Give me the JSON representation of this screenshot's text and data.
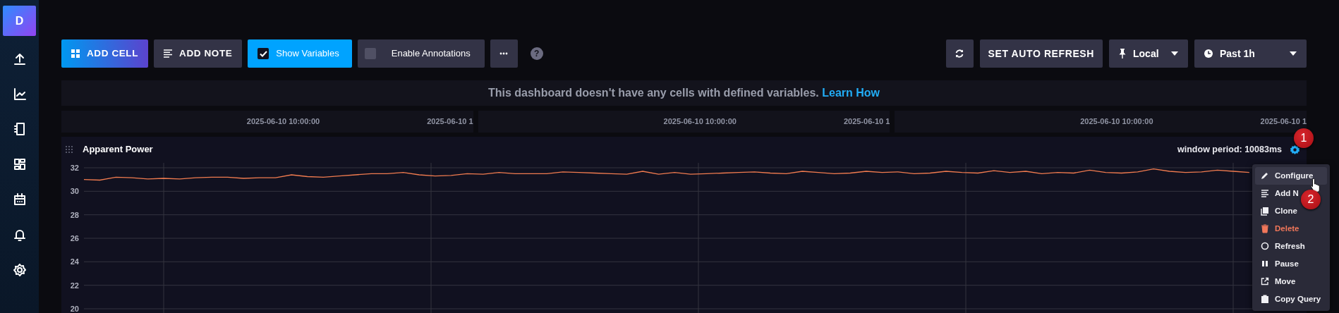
{
  "sidebar": {
    "logo": "D"
  },
  "toolbar": {
    "add_cell": "ADD CELL",
    "add_note": "ADD NOTE",
    "show_variables": {
      "label": "Show Variables",
      "checked": true
    },
    "enable_annotations": {
      "label": "Enable Annotations",
      "checked": false
    },
    "help": "?",
    "auto_refresh": "SET AUTO REFRESH",
    "timezone": "Local",
    "time_range": "Past 1h"
  },
  "banner": {
    "text": "This dashboard doesn't have any cells with defined variables.",
    "link": "Learn How"
  },
  "cells_above": [
    {
      "labels": [
        "2025-06-10 10:00:00",
        "2025-06-10 1"
      ]
    },
    {
      "labels": [
        "2025-06-10 10:00:00",
        "2025-06-10 1"
      ]
    },
    {
      "labels": [
        "2025-06-10 10:00:00",
        "2025-06-10 1"
      ]
    }
  ],
  "cell": {
    "title": "Apparent Power",
    "window_period": "window period: 10083ms",
    "chart_data": {
      "type": "line",
      "grid": true,
      "ylim": [
        20,
        32.3
      ],
      "yticks": [
        20,
        22,
        24,
        26,
        28,
        30,
        32
      ],
      "series": [
        {
          "color": "#f07b4f",
          "values": [
            31.0,
            30.95,
            31.2,
            31.15,
            31.05,
            31.1,
            31.05,
            31.15,
            31.2,
            31.2,
            31.1,
            31.15,
            31.15,
            31.4,
            31.25,
            31.2,
            31.3,
            31.4,
            31.5,
            31.5,
            31.6,
            31.4,
            31.3,
            31.35,
            31.5,
            31.45,
            31.6,
            31.5,
            31.5,
            31.5,
            31.65,
            31.6,
            31.55,
            31.5,
            31.45,
            31.7,
            31.45,
            31.6,
            31.45,
            31.5,
            31.55,
            31.6,
            31.65,
            31.55,
            31.5,
            31.7,
            31.6,
            31.5,
            31.55,
            31.7,
            31.6,
            31.65,
            31.5,
            31.55,
            31.7,
            31.6,
            31.55,
            31.75,
            31.6,
            31.7,
            31.5,
            31.6,
            31.55,
            31.8,
            31.6,
            31.55,
            31.65,
            31.9,
            31.7,
            31.6,
            31.65,
            31.8,
            31.7,
            31.6,
            null,
            null,
            null,
            null,
            null
          ]
        }
      ]
    }
  },
  "context_menu": {
    "items": [
      {
        "label": "Configure",
        "kind": "configure",
        "hovered": true
      },
      {
        "label": "Add N",
        "kind": "note",
        "hovered": false
      },
      {
        "label": "Clone",
        "kind": "clone",
        "hovered": false
      },
      {
        "label": "Delete",
        "kind": "delete",
        "hovered": false
      },
      {
        "label": "Refresh",
        "kind": "refresh",
        "hovered": false
      },
      {
        "label": "Pause",
        "kind": "pause",
        "hovered": false
      },
      {
        "label": "Move",
        "kind": "move",
        "hovered": false
      },
      {
        "label": "Copy Query",
        "kind": "copy",
        "hovered": false
      }
    ]
  },
  "callouts": [
    "1",
    "2"
  ]
}
